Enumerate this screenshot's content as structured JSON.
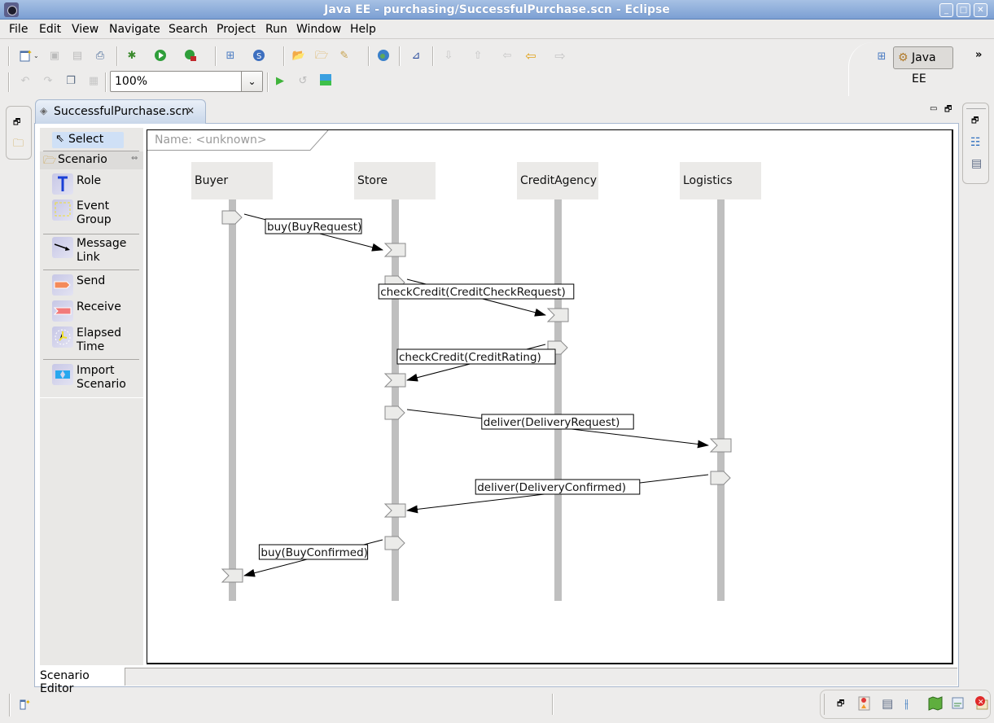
{
  "window": {
    "title": "Java EE - purchasing/SuccessfulPurchase.scn - Eclipse",
    "controls": [
      "minimize",
      "maximize",
      "close"
    ]
  },
  "menubar": {
    "items": [
      {
        "label": "File",
        "mnemonic": "F"
      },
      {
        "label": "Edit",
        "mnemonic": "E"
      },
      {
        "label": "View",
        "mnemonic": ""
      },
      {
        "label": "Navigate",
        "mnemonic": "N"
      },
      {
        "label": "Search",
        "mnemonic": "a"
      },
      {
        "label": "Project",
        "mnemonic": "P"
      },
      {
        "label": "Run",
        "mnemonic": "R"
      },
      {
        "label": "Window",
        "mnemonic": "W"
      },
      {
        "label": "Help",
        "mnemonic": "H"
      }
    ]
  },
  "toolbar": {
    "zoom_value": "100%",
    "icons_row1": [
      "new-wizard-icon",
      "save-icon",
      "save-all-icon",
      "print-icon",
      "debug-icon",
      "run-icon",
      "external-tools-icon",
      "new-server-icon",
      "new-web-service-icon",
      "open-type-icon",
      "open-resource-icon",
      "search-icon",
      "web-browser-icon",
      "run-as-icon",
      "next-annotation-icon",
      "previous-annotation-icon",
      "last-edit-location-icon",
      "back-icon",
      "forward-icon"
    ],
    "icons_row2": [
      "undo-icon",
      "redo-icon",
      "copy-icon",
      "paste-icon",
      "simulate-icon",
      "reset-icon",
      "export-image-icon"
    ]
  },
  "perspective": {
    "open_perspective_icon": "open-perspective-icon",
    "active_label": "Java EE",
    "overflow": "»"
  },
  "editor": {
    "tab_label": "SuccessfulPurchase.scn",
    "bottom_tab_label": "Scenario Editor"
  },
  "palette": {
    "select_label": "Select",
    "drawer_label": "Scenario",
    "tools": [
      {
        "label": "Role",
        "icon": "role-icon"
      },
      {
        "label": "Event Group",
        "icon": "event-group-icon"
      },
      {
        "label": "Message Link",
        "icon": "message-link-icon"
      },
      {
        "label": "Send",
        "icon": "send-icon"
      },
      {
        "label": "Receive",
        "icon": "receive-icon"
      },
      {
        "label": "Elapsed Time",
        "icon": "elapsed-time-icon"
      },
      {
        "label": "Import Scenario",
        "icon": "import-scenario-icon"
      }
    ]
  },
  "diagram": {
    "name_label": "Name: <unknown>",
    "roles": [
      "Buyer",
      "Store",
      "CreditAgency",
      "Logistics"
    ],
    "messages": [
      {
        "label": "buy(BuyRequest)",
        "from": 0,
        "to": 1
      },
      {
        "label": "checkCredit(CreditCheckRequest)",
        "from": 1,
        "to": 2
      },
      {
        "label": "checkCredit(CreditRating)",
        "from": 2,
        "to": 1
      },
      {
        "label": "deliver(DeliveryRequest)",
        "from": 1,
        "to": 3
      },
      {
        "label": "deliver(DeliveryConfirmed)",
        "from": 3,
        "to": 1
      },
      {
        "label": "buy(BuyConfirmed)",
        "from": 1,
        "to": 0
      }
    ]
  },
  "statusbar": {
    "trim_icons": [
      "restore-icon",
      "bookmarks-icon",
      "properties-icon",
      "tasks-icon",
      "servers-icon",
      "data-source-explorer-icon",
      "problems-icon"
    ]
  }
}
